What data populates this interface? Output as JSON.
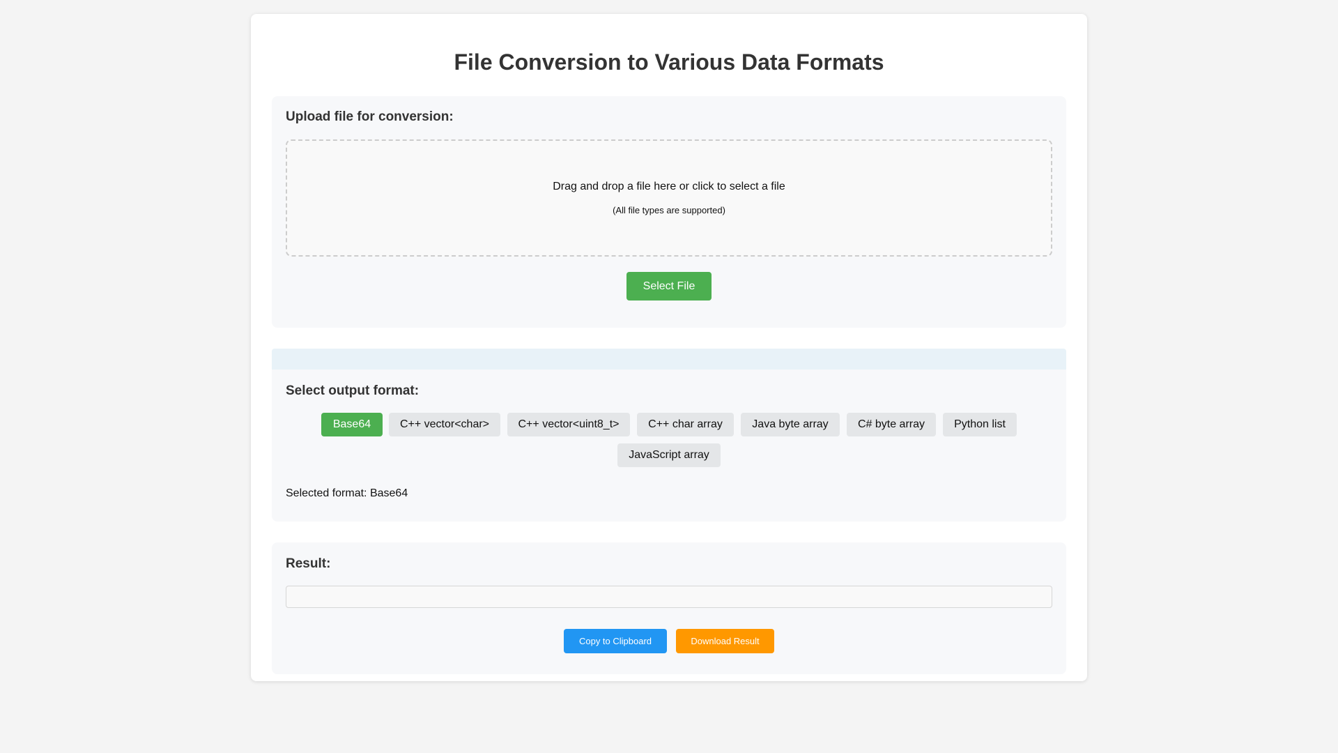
{
  "page": {
    "title": "File Conversion to Various Data Formats"
  },
  "upload": {
    "heading": "Upload file for conversion:",
    "dropzone_text": "Drag and drop a file here or click to select a file",
    "dropzone_subtext": "(All file types are supported)",
    "select_button_label": "Select File"
  },
  "format": {
    "heading": "Select output format:",
    "options": [
      {
        "label": "Base64",
        "active": true
      },
      {
        "label": "C++ vector<char>",
        "active": false
      },
      {
        "label": "C++ vector<uint8_t>",
        "active": false
      },
      {
        "label": "C++ char array",
        "active": false
      },
      {
        "label": "Java byte array",
        "active": false
      },
      {
        "label": "C# byte array",
        "active": false
      },
      {
        "label": "Python list",
        "active": false
      },
      {
        "label": "JavaScript array",
        "active": false
      }
    ],
    "selected_text": "Selected format: Base64"
  },
  "result": {
    "heading": "Result:",
    "output_value": "",
    "copy_button_label": "Copy to Clipboard",
    "download_button_label": "Download Result"
  },
  "colors": {
    "primary_green": "#4caf50",
    "copy_blue": "#2196f3",
    "download_orange": "#ff9800"
  }
}
